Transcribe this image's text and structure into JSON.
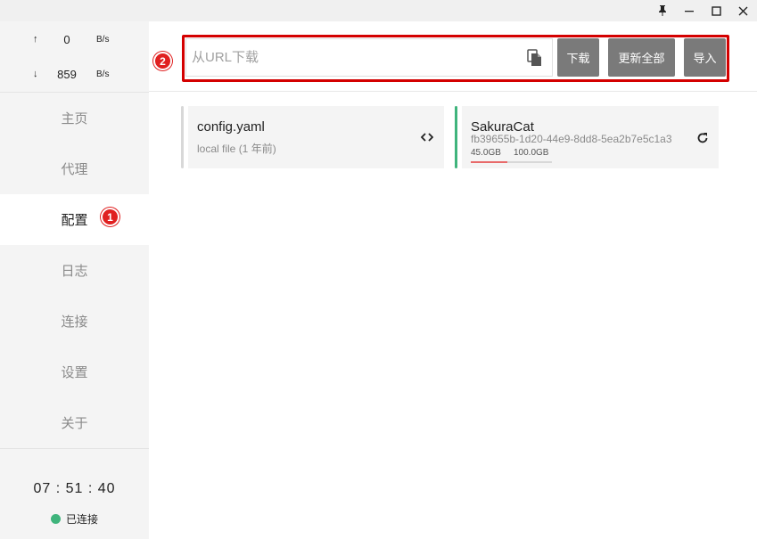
{
  "speed": {
    "upload": {
      "arrow": "↑",
      "value": "0",
      "unit": "B/s"
    },
    "download": {
      "arrow": "↓",
      "value": "859",
      "unit": "B/s"
    }
  },
  "nav": [
    "主页",
    "代理",
    "配置",
    "日志",
    "连接",
    "设置",
    "关于"
  ],
  "active_nav": "配置",
  "clock": "07 : 51 : 40",
  "status": "已连接",
  "badges": [
    "1",
    "2"
  ],
  "url_input": {
    "placeholder": "从URL下载",
    "value": ""
  },
  "buttons": {
    "download": "下载",
    "update_all": "更新全部",
    "import": "导入"
  },
  "profiles": [
    {
      "name": "config.yaml",
      "subtitle": "local file (1 年前)",
      "icon": "code-icon",
      "accent": "#d8d8d8"
    },
    {
      "name": "SakuraCat",
      "subtitle": "fb39655b-1d20-44e9-8dd8-5ea2b7e5c1a3",
      "used": "45.0GB",
      "total": "100.0GB",
      "usage_fraction": 0.45,
      "icon": "refresh-icon",
      "accent": "#3fb47c"
    }
  ],
  "colors": {
    "accent_green": "#3fb47c",
    "highlight_red": "#d40000",
    "button_gray": "#7a7a7a",
    "sidebar_bg": "#f4f4f4"
  }
}
